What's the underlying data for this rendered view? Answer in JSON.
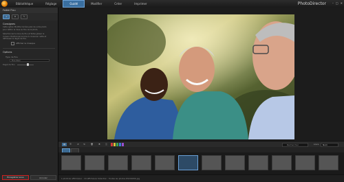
{
  "app": {
    "brand": "PhotoDirector"
  },
  "nav": {
    "tabs": [
      {
        "label": "Bibliothèque"
      },
      {
        "label": "Réglage"
      },
      {
        "label": "Guidé",
        "active": true
      },
      {
        "label": "Modifier"
      },
      {
        "label": "Créer"
      },
      {
        "label": "Imprimer"
      }
    ]
  },
  "window": {
    "minimize": "–",
    "maximize": "□",
    "close": "✕"
  },
  "left": {
    "header": "Faible Flou",
    "section1_title": "Consignes",
    "para1": "Cette option Modifie l'arrière-plan de votre photo pour définir la mise au flou de la photo.",
    "para2": "Sélectionnez la zone de flou et faites glisser le curseur. Positionnez la zone à conserver nette et définissez le degré de flou.",
    "checkbox_label": "Afficher le masque",
    "section2_title": "Options",
    "type_label": "Type de flou",
    "type_value": "Flou doux",
    "slider_label": "Degré de flou",
    "save_label": "Enregistrer sous",
    "cancel_label": "Annuler"
  },
  "toolbar": {
    "search_placeholder": "Rechercher",
    "sort_label": "Livre",
    "sort_value": "Nom"
  },
  "status": {
    "text": "1 photo(s) affichée(s) – 24 affichée(s)   Sélection : Toutes les photos   DSC00456.jpg"
  },
  "filmstrip": {
    "count": 12,
    "selected_index": 5
  }
}
